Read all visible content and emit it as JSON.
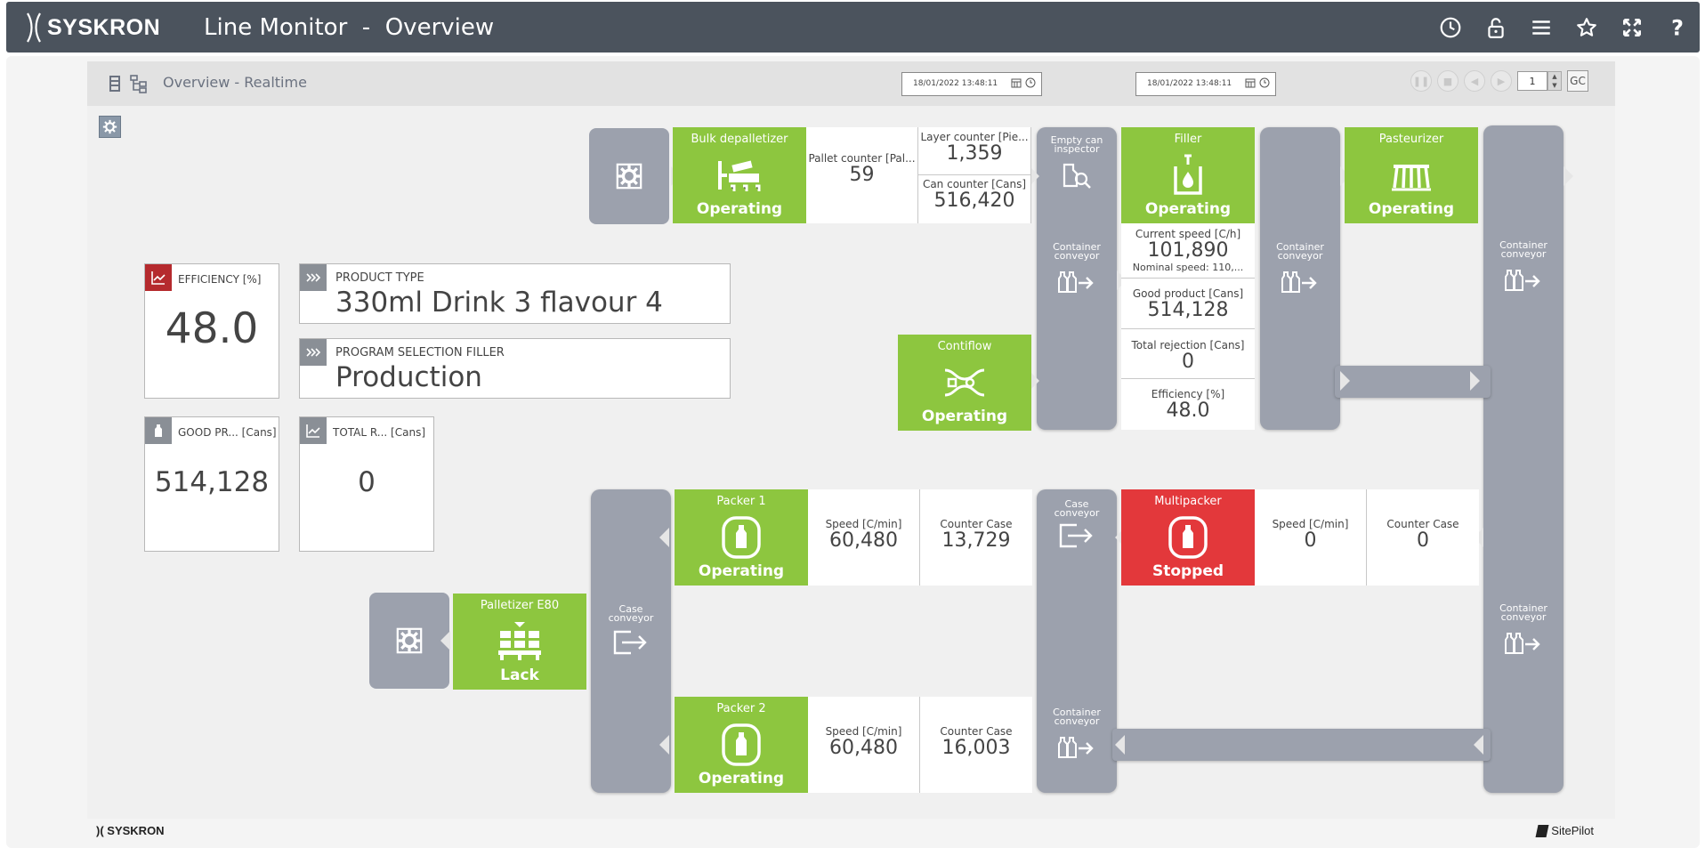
{
  "app": {
    "brand": "SYSKRON",
    "title": "Line Monitor  -  Overview",
    "top_icons": [
      "clock-icon",
      "unlock-icon",
      "menu-icon",
      "star-icon",
      "fullscreen-icon",
      "help-icon"
    ]
  },
  "toolbar": {
    "title": "Overview - Realtime",
    "date_from": "18/01/2022 13:48:11",
    "date_to": "18/01/2022 13:48:11",
    "page": "1",
    "gc_label": "GC"
  },
  "kpis": {
    "efficiency": {
      "label": "EFFICIENCY [%]",
      "value": "48.0"
    },
    "good_product": {
      "label": "GOOD PR... [Cans]",
      "value": "514,128"
    },
    "total_rejection": {
      "label": "TOTAL R... [Cans]",
      "value": "0"
    },
    "product_type": {
      "label": "PRODUCT TYPE",
      "value": "330ml Drink 3 flavour 4"
    },
    "program_selection": {
      "label": "PROGRAM SELECTION FILLER",
      "value": "Production"
    }
  },
  "machines": {
    "bulk_depalletizer": {
      "name": "Bulk depalletizer",
      "state": "Operating"
    },
    "filler": {
      "name": "Filler",
      "state": "Operating"
    },
    "pasteurizer": {
      "name": "Pasteurizer",
      "state": "Operating"
    },
    "contiflow": {
      "name": "Contiflow",
      "state": "Operating"
    },
    "packer1": {
      "name": "Packer 1",
      "state": "Operating"
    },
    "packer2": {
      "name": "Packer 2",
      "state": "Operating"
    },
    "multipacker": {
      "name": "Multipacker",
      "state": "Stopped"
    },
    "palletizer": {
      "name": "Palletizer E80",
      "state": "Lack"
    }
  },
  "depal_data": {
    "pallet_label": "Pallet counter [Pal...",
    "pallet_value": "59",
    "layer_label": "Layer counter [Pie...",
    "layer_value": "1,359",
    "can_label": "Can counter [Cans]",
    "can_value": "516,420"
  },
  "filler_data": {
    "speed_label": "Current speed [C/h]",
    "speed_value": "101,890",
    "nominal": "Nominal speed: 110,...",
    "good_label": "Good product [Cans]",
    "good_value": "514,128",
    "rej_label": "Total rejection [Cans]",
    "rej_value": "0",
    "eff_label": "Efficiency [%]",
    "eff_value": "48.0"
  },
  "packer1_data": {
    "speed_label": "Speed [C/min]",
    "speed_value": "60,480",
    "count_label": "Counter Case",
    "count_value": "13,729"
  },
  "packer2_data": {
    "speed_label": "Speed [C/min]",
    "speed_value": "60,480",
    "count_label": "Counter Case",
    "count_value": "16,003"
  },
  "multipacker_data": {
    "speed_label": "Speed [C/min]",
    "speed_value": "0",
    "count_label": "Counter Case",
    "count_value": "0"
  },
  "conveyors": {
    "empty_can_inspector": "Empty can inspector",
    "container": "Container conveyor",
    "case": "Case conveyor"
  },
  "footer": {
    "left": "SYSKRON",
    "right": "SitePilot"
  },
  "colors": {
    "operating": "#8dc63f",
    "stopped": "#e3383b",
    "conveyor": "#9ca1ad",
    "topbar": "#4b535d"
  }
}
